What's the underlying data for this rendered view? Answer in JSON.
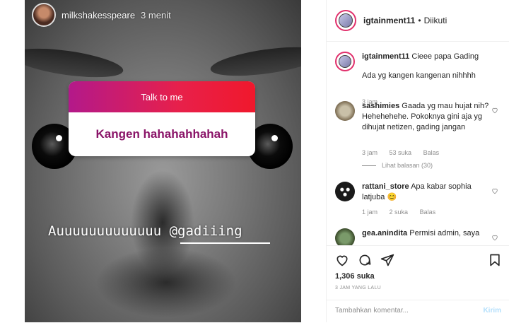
{
  "story": {
    "username": "milkshakesspeare",
    "time": "3 menit",
    "question_title": "Talk to me",
    "question_answer": "Kangen hahahahhahah",
    "caption": "Auuuuuuuuuuuuu @gadiiing"
  },
  "post": {
    "username": "igtainment11",
    "separator": "•",
    "follow_status": "Diikuti",
    "caption_line1": "Cieee papa Gading",
    "caption_line2": "Ada yg kangen kangenan nihhhh",
    "caption_time": "3 jam",
    "likes": "1,306 suka",
    "post_time": "3 JAM YANG LALU",
    "comment_placeholder": "Tambahkan komentar...",
    "post_button": "Kirim"
  },
  "comments": [
    {
      "username": "sashimies",
      "text": "Gaada yg mau hujat nih? Hehehehehe. Pokoknya gini aja yg dihujat netizen, gading jangan",
      "time": "3 jam",
      "likes": "53 suka",
      "reply": "Balas",
      "view_replies": "Lihat balasan (30)"
    },
    {
      "username": "rattani_store",
      "text": "Apa kabar sophia latjuba",
      "emoji": "😊",
      "time": "1 jam",
      "likes": "2 suka",
      "reply": "Balas"
    },
    {
      "username": "gea.anindita",
      "text": "Permisi admin, saya"
    }
  ],
  "colors": {
    "question_gradient_start": "#b3198a",
    "question_gradient_end": "#f0182c",
    "answer_text": "#8a1468",
    "post_button": "#b2dffc",
    "muted": "#8e8e8e"
  }
}
